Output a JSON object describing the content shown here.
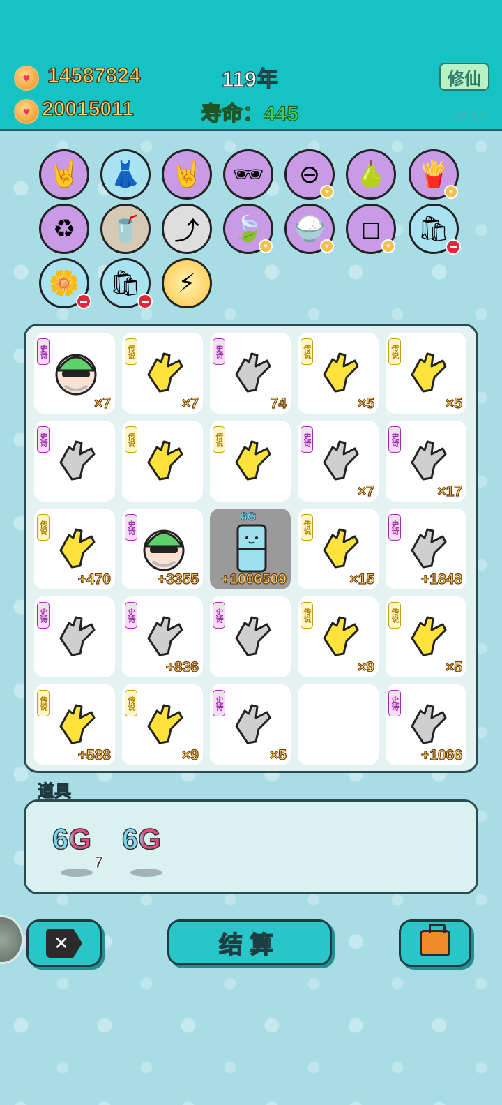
{
  "header": {
    "coins_primary": "14587824",
    "coins_secondary": "20015011",
    "year": "119年",
    "lifespan_label": "寿命：",
    "lifespan_value": "445",
    "cultivate_button": "修仙",
    "version": "v2.1.0"
  },
  "items_row1": [
    "rock-hand-icon",
    "skirt-icon",
    "rock-hand-icon",
    "sunglasses-fruit-icon",
    "no-entry-icon",
    "pomelo-icon",
    "fries-icon"
  ],
  "items_row2": [
    "recycle-icon",
    "bubble-tea-icon",
    "arrow-card-icon",
    "leaf-icon",
    "rice-bowl-icon",
    "sugar-cubes-icon",
    "trash-bag-icon"
  ],
  "items_row3": [
    "flower-pot-icon",
    "trash-bag-icon",
    "lightning-icon"
  ],
  "board": {
    "tags": {
      "epic": "史诗",
      "legend": "传说"
    },
    "cells": [
      {
        "tag": "epic",
        "icon": "face-icon",
        "count": "×7"
      },
      {
        "tag": "legend",
        "icon": "hand-icon",
        "count": "×7"
      },
      {
        "tag": "epic",
        "icon": "hand-icon",
        "count": "74"
      },
      {
        "tag": "legend",
        "icon": "hand-icon",
        "count": "×5"
      },
      {
        "tag": "legend",
        "icon": "hand-icon",
        "count": "×5"
      },
      {
        "tag": "epic",
        "icon": "hand-icon",
        "count": ""
      },
      {
        "tag": "legend",
        "icon": "hand-icon",
        "count": ""
      },
      {
        "tag": "legend",
        "icon": "hand-icon",
        "count": ""
      },
      {
        "tag": "epic",
        "icon": "hand-icon",
        "count": "×7"
      },
      {
        "tag": "epic",
        "icon": "hand-icon",
        "count": "×17"
      },
      {
        "tag": "legend",
        "icon": "hand-icon",
        "count": "+470"
      },
      {
        "tag": "epic",
        "icon": "face-icon",
        "count": "+3355"
      },
      {
        "tag": "",
        "icon": "fridge-icon",
        "count": "+1006509",
        "label": "6G"
      },
      {
        "tag": "legend",
        "icon": "hand-icon",
        "count": "×15"
      },
      {
        "tag": "epic",
        "icon": "hand-icon",
        "count": "+1848"
      },
      {
        "tag": "epic",
        "icon": "hand-icon",
        "count": ""
      },
      {
        "tag": "epic",
        "icon": "hand-icon",
        "count": "+836"
      },
      {
        "tag": "epic",
        "icon": "hand-icon",
        "count": ""
      },
      {
        "tag": "legend",
        "icon": "hand-icon",
        "count": "×9"
      },
      {
        "tag": "legend",
        "icon": "hand-icon",
        "count": "×5"
      },
      {
        "tag": "legend",
        "icon": "hand-icon",
        "count": "+588"
      },
      {
        "tag": "legend",
        "icon": "hand-icon",
        "count": "×9"
      },
      {
        "tag": "epic",
        "icon": "hand-icon",
        "count": "×5"
      },
      {
        "tag": "",
        "icon": "",
        "count": ""
      },
      {
        "tag": "epic",
        "icon": "hand-icon",
        "count": "+1066"
      }
    ]
  },
  "props": {
    "title": "道具",
    "items": [
      {
        "label": "6G",
        "count": "7"
      },
      {
        "label": "6G",
        "count": ""
      }
    ]
  },
  "buttons": {
    "settle": "结算"
  }
}
